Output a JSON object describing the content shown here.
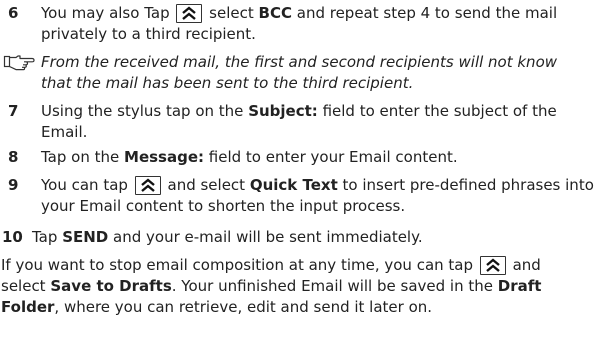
{
  "steps": {
    "s6": {
      "num": "6",
      "t1": "You may also Tap",
      "t2": "select",
      "b1": "BCC",
      "t3": "and repeat step 4 to send the mail",
      "t4": "privately to a third recipient."
    },
    "note": {
      "l1": "From the received mail, the first and second recipients will not know",
      "l2": "that the mail has been sent to the third recipient."
    },
    "s7": {
      "num": "7",
      "t1": "Using the stylus tap on the",
      "b1": "Subject:",
      "t2": "field to enter the subject of the",
      "t3": "Email."
    },
    "s8": {
      "num": "8",
      "t1": "Tap on the",
      "b1": "Message:",
      "t2": "field to enter your Email content."
    },
    "s9": {
      "num": "9",
      "t1": "You can tap",
      "t2": "and select",
      "b1": "Quick Text",
      "t3": "to insert pre-defined phrases into",
      "t4": "your Email content to shorten the input process."
    },
    "s10": {
      "num": "10",
      "t1": "Tap",
      "b1": "SEND",
      "t2": "and your e-mail will be sent immediately."
    }
  },
  "closing": {
    "t1": "If you want to stop email composition at any time, you can tap",
    "t2": "and",
    "t3": "select",
    "b1": "Save to Drafts",
    "t4": ". Your unfinished Email will be saved in the",
    "b2": "Draft",
    "b3": "Folder",
    "t5": ", where you can retrieve, edit and send it later on."
  },
  "icons": {
    "menu_button": "double-chevron-up-icon",
    "note": "pointing-hand-note-icon"
  }
}
